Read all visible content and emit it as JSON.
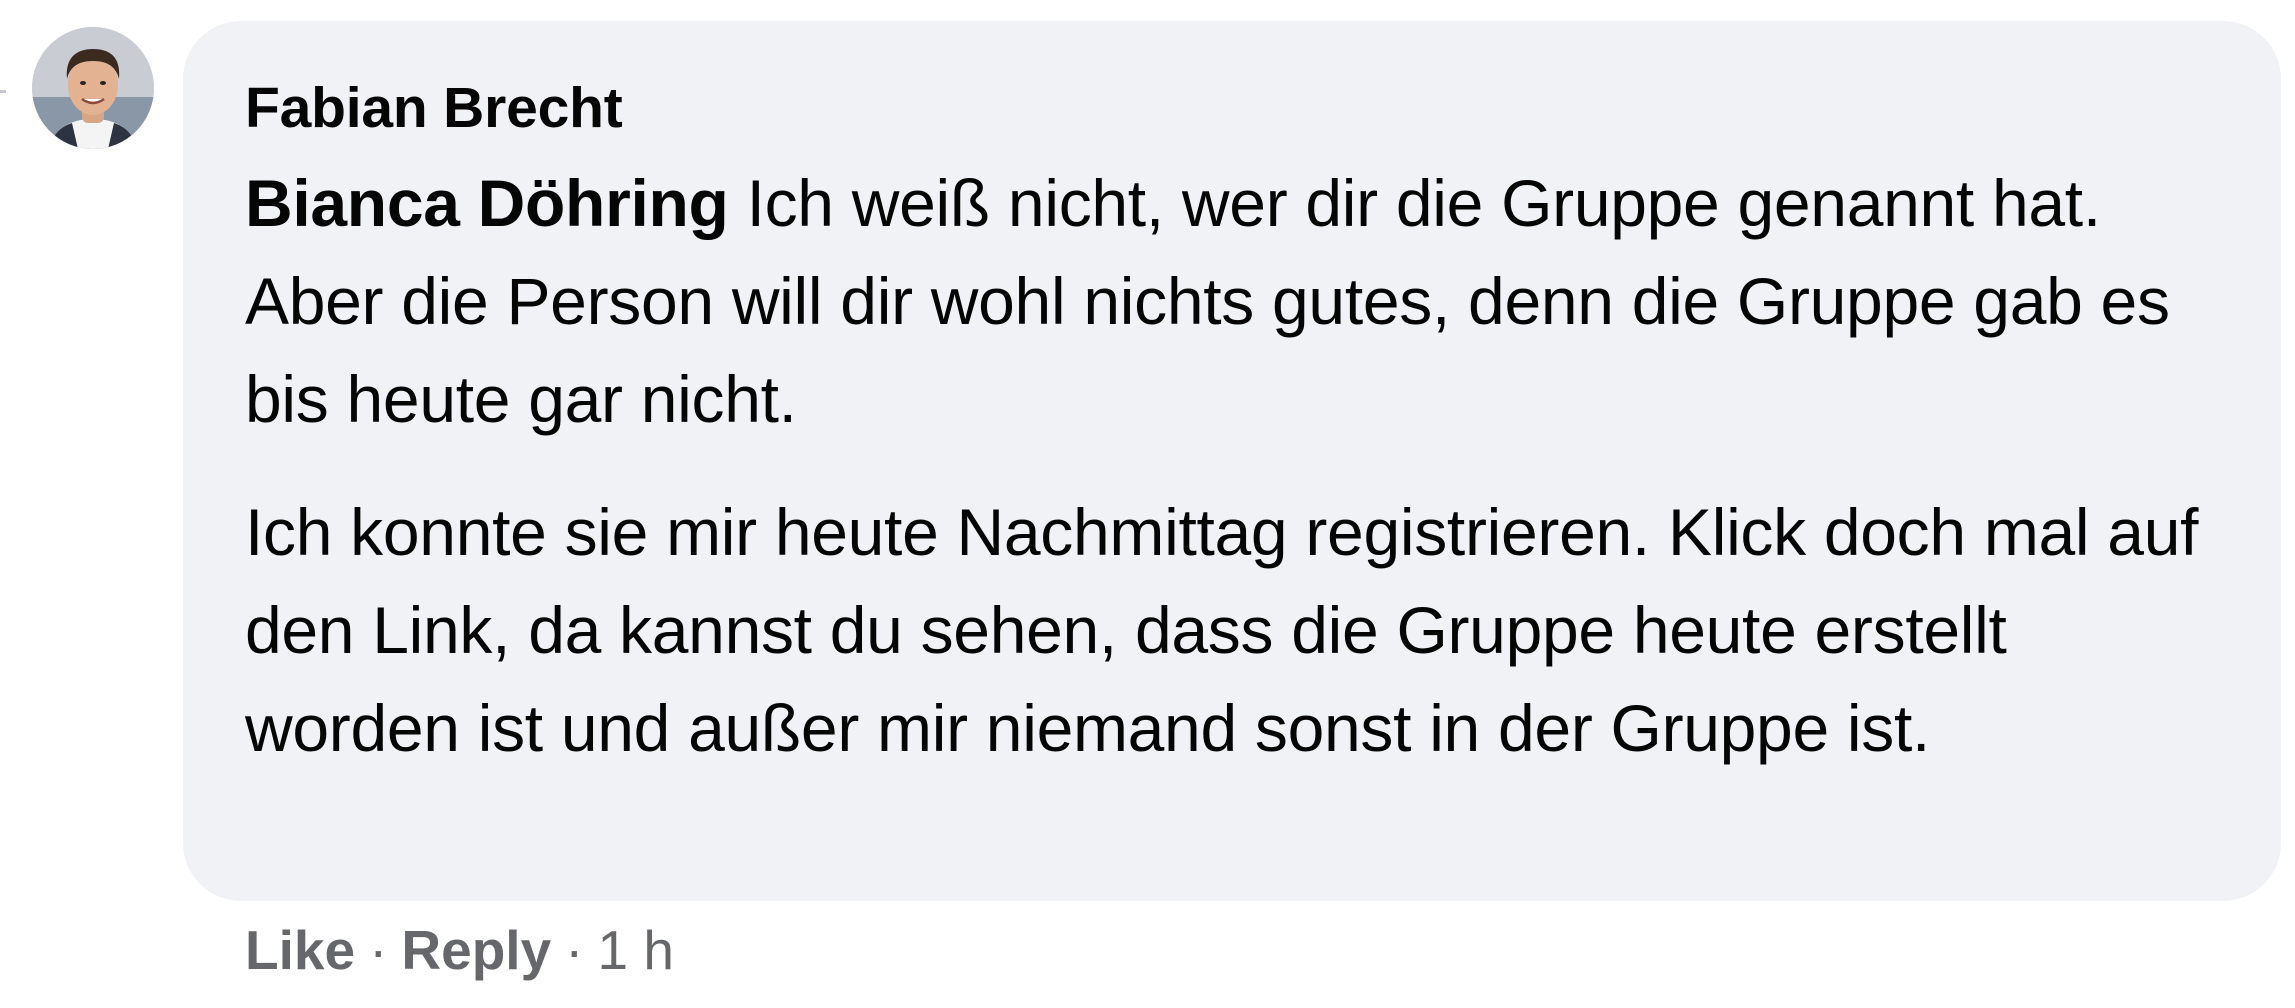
{
  "comment": {
    "author": "Fabian Brecht",
    "mention": "Bianca Döhring",
    "paragraph_1_text": " Ich weiß nicht, wer dir die Gruppe genannt hat. Aber die Person will dir wohl nichts gutes, denn die Gruppe gab es bis heute gar nicht.",
    "paragraph_2": "Ich konnte sie mir heute Nachmittag registrieren. Klick doch mal auf den Link, da kannst du sehen, dass die Gruppe heute erstellt worden ist und außer mir niemand sonst in der Gruppe ist."
  },
  "actions": {
    "like_label": "Like",
    "reply_label": "Reply",
    "separator": "·",
    "timestamp": "1 h"
  },
  "colors": {
    "bubble_bg": "#f0f2f5",
    "text": "#050505",
    "secondary_text": "#65676b"
  },
  "icons": {
    "avatar": "profile-photo"
  }
}
